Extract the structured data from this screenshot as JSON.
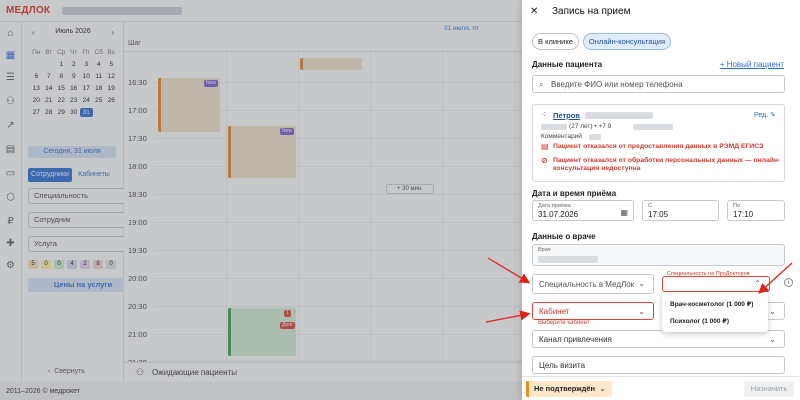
{
  "app": {
    "logo": "МЕДЛОК",
    "copyright": "2011–2026 © медрокет"
  },
  "rail_icons": [
    "home-icon",
    "calendar-icon",
    "list-icon",
    "users-icon",
    "chart-icon",
    "doc-icon",
    "card-icon",
    "box-icon",
    "ruble-icon",
    "puzzle-icon",
    "settings-icon"
  ],
  "calendar": {
    "month": "Июль 2026",
    "weekdays": [
      "Пн",
      "Вт",
      "Ср",
      "Чт",
      "Пт",
      "Сб",
      "Вс"
    ],
    "days": [
      "",
      "",
      "1",
      "2",
      "3",
      "4",
      "5",
      "6",
      "7",
      "8",
      "9",
      "10",
      "11",
      "12",
      "13",
      "14",
      "15",
      "16",
      "17",
      "18",
      "19",
      "20",
      "21",
      "22",
      "23",
      "24",
      "25",
      "26",
      "27",
      "28",
      "29",
      "30",
      "31",
      "",
      ""
    ],
    "selected": "31",
    "today_label": "Сегодня, 31 июля"
  },
  "filters": {
    "tab_staff": "Сотрудники",
    "tab_rooms": "Кабинеты",
    "specialty": "Специальность",
    "employee": "Сотрудник",
    "service": "Услуга",
    "chips": [
      "5",
      "0",
      "0",
      "4",
      "2",
      "8",
      "0"
    ],
    "prices_button": "Цены на услуги",
    "collapse": "Свернуть"
  },
  "schedule": {
    "step": "Шаг",
    "date_header": "31 июля, пт",
    "times": [
      "16:30",
      "17:00",
      "17:30",
      "18:00",
      "18:30",
      "19:00",
      "19:30",
      "20:00",
      "20:30",
      "21:00",
      "21:30"
    ],
    "badge_new": "New",
    "badge_count": "1",
    "badge_debt": "Долг",
    "plus30": "+ 30 мин.",
    "waiting": "Ожидающие пациенты"
  },
  "drawer": {
    "close": "✕",
    "title": "Запись на прием",
    "tab_clinic": "В клинике",
    "tab_online": "Онлайн-консультация",
    "patient_section": "Данные пациента",
    "new_patient": "+ Новый пациент",
    "search_placeholder": "Введите ФИО или номер телефона",
    "patient": {
      "name": "Петров",
      "edit": "Ред.",
      "age": "(27 лет) • +7 9",
      "comment": "Комментарий",
      "warning1": "Пациент отказался от предоставления данных в РЭМД ЕГИСЗ",
      "warning2": "Пациент отказался от обработки персональных данных — онлайн-консультация недоступна"
    },
    "datetime_section": "Дата и время приёма",
    "date_label": "Дата приёма",
    "date_value": "31.07.2026",
    "from_label": "С",
    "from_value": "17:05",
    "to_label": "По",
    "to_value": "17:10",
    "doctor_section": "Данные о враче",
    "doctor_label": "Врач",
    "specialty_medlok": "Специальность в МедЛок",
    "specialty_prodoctorov": "Специальность на ПроДокторов",
    "cabinet": "Кабинет",
    "cabinet_error": "Выберите кабинет",
    "dropdown_options": [
      "Врач-косметолог (1 000 ₽)",
      "Психолог (1 000 ₽)"
    ],
    "channel": "Канал привлечения",
    "visit_goal": "Цель визита",
    "status": "Не подтверждён",
    "submit": "Назначить"
  },
  "colors": {
    "accent": "#2d6fd6",
    "error": "#d03a2f",
    "status": "#f08a1c"
  }
}
